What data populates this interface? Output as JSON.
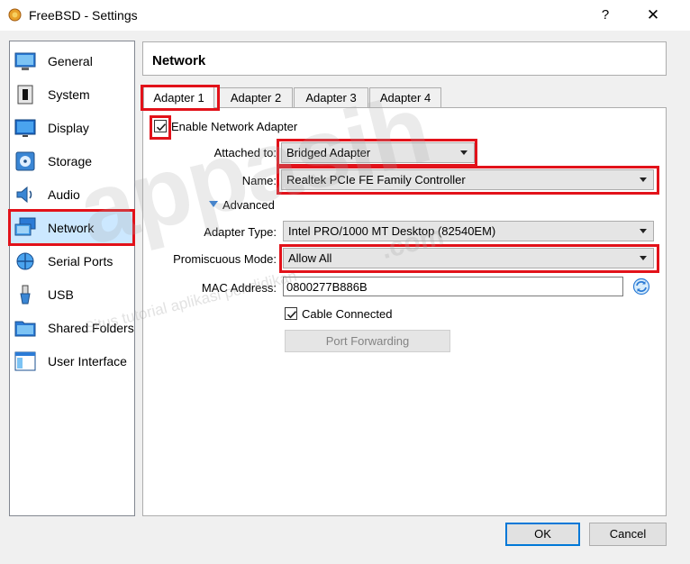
{
  "window": {
    "title": "FreeBSD - Settings",
    "help_glyph": "?",
    "close_glyph": "✕"
  },
  "sidebar": {
    "items": [
      {
        "label": "General",
        "icon": "general-icon"
      },
      {
        "label": "System",
        "icon": "system-icon"
      },
      {
        "label": "Display",
        "icon": "display-icon"
      },
      {
        "label": "Storage",
        "icon": "storage-icon"
      },
      {
        "label": "Audio",
        "icon": "audio-icon"
      },
      {
        "label": "Network",
        "icon": "network-icon",
        "selected": true
      },
      {
        "label": "Serial Ports",
        "icon": "serial-ports-icon"
      },
      {
        "label": "USB",
        "icon": "usb-icon"
      },
      {
        "label": "Shared Folders",
        "icon": "shared-folders-icon"
      },
      {
        "label": "User Interface",
        "icon": "user-interface-icon"
      }
    ]
  },
  "header": {
    "title": "Network"
  },
  "tabs": [
    {
      "label": "Adapter 1",
      "active": true
    },
    {
      "label": "Adapter 2"
    },
    {
      "label": "Adapter 3"
    },
    {
      "label": "Adapter 4"
    }
  ],
  "form": {
    "enable_label": "Enable Network Adapter",
    "enable_checked": true,
    "attached_label": "Attached to:",
    "attached_value": "Bridged Adapter",
    "name_label": "Name:",
    "name_value": "Realtek PCIe FE Family Controller",
    "advanced_label": "Advanced",
    "adapter_type_label": "Adapter Type:",
    "adapter_type_value": "Intel PRO/1000 MT Desktop (82540EM)",
    "promiscuous_label": "Promiscuous Mode:",
    "promiscuous_value": "Allow All",
    "mac_label": "MAC Address:",
    "mac_value": "0800277B886B",
    "cable_label": "Cable Connected",
    "cable_checked": true,
    "port_forwarding_label": "Port Forwarding"
  },
  "footer": {
    "ok_label": "OK",
    "cancel_label": "Cancel"
  },
  "watermark": {
    "main": "appasih",
    "dotcom": ".com",
    "tagline": "Situs tutorial aplikasi pendidikan"
  },
  "colors": {
    "highlight_red": "#e2121a",
    "accent_blue": "#0078d7",
    "selection_bg": "#cce8ff"
  }
}
